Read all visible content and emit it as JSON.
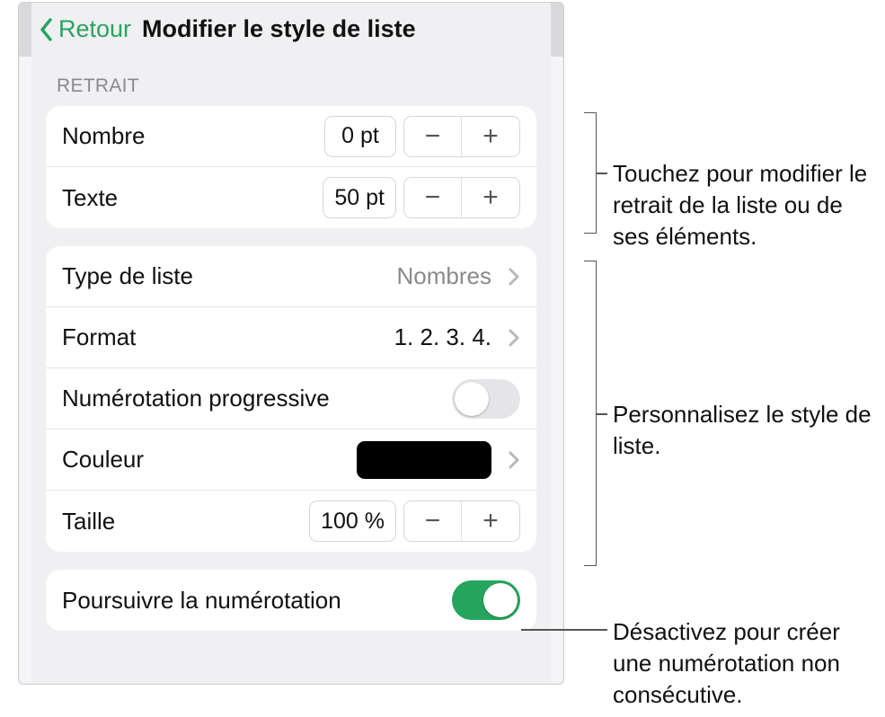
{
  "header": {
    "back_label": "Retour",
    "title": "Modifier le style de liste"
  },
  "sections": {
    "indent": {
      "header": "Retrait",
      "number_label": "Nombre",
      "number_value": "0 pt",
      "text_label": "Texte",
      "text_value": "50 pt"
    },
    "style": {
      "list_type_label": "Type de liste",
      "list_type_value": "Nombres",
      "format_label": "Format",
      "format_value": "1. 2. 3. 4.",
      "tiered_label": "Numérotation progressive",
      "tiered_on": false,
      "color_label": "Couleur",
      "color_value": "#000000",
      "size_label": "Taille",
      "size_value": "100 %"
    },
    "continue": {
      "label": "Poursuivre la numérotation",
      "on": true
    }
  },
  "glyphs": {
    "minus": "−",
    "plus": "+"
  },
  "callouts": {
    "indent": "Touchez pour modifier le retrait de la liste ou de ses éléments.",
    "style": "Personnalisez le style de liste.",
    "continue": "Désactivez pour créer une numérotation non consécutive."
  }
}
